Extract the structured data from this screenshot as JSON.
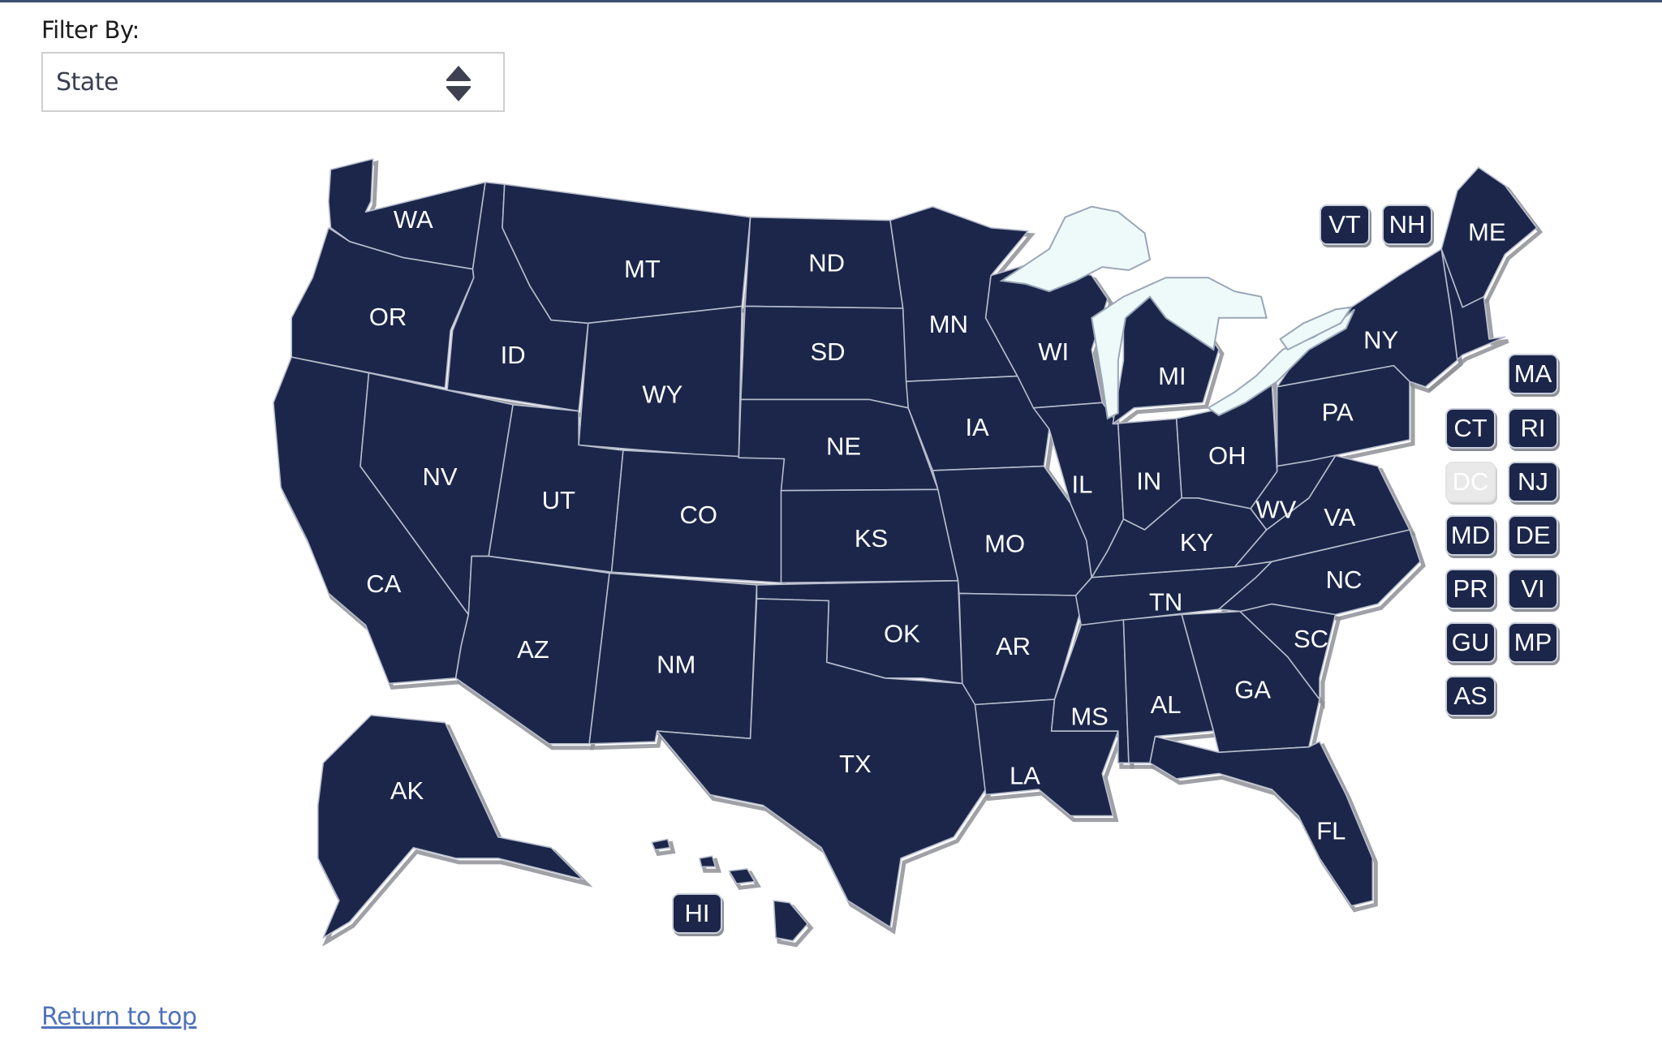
{
  "filter": {
    "label": "Filter By:",
    "selected": "State",
    "icon": "sort-updown-icon"
  },
  "colors": {
    "state_fill": "#1b264a",
    "state_border": "#b7bccb",
    "lake_fill": "#eefaf9",
    "disabled_chip": "#e9e9e9",
    "link": "#4f72b8"
  },
  "map": {
    "title": "United States map",
    "states": [
      {
        "abbr": "WA"
      },
      {
        "abbr": "OR"
      },
      {
        "abbr": "CA"
      },
      {
        "abbr": "ID"
      },
      {
        "abbr": "NV"
      },
      {
        "abbr": "MT"
      },
      {
        "abbr": "WY"
      },
      {
        "abbr": "UT"
      },
      {
        "abbr": "AZ"
      },
      {
        "abbr": "CO"
      },
      {
        "abbr": "NM"
      },
      {
        "abbr": "ND"
      },
      {
        "abbr": "SD"
      },
      {
        "abbr": "NE"
      },
      {
        "abbr": "KS"
      },
      {
        "abbr": "OK"
      },
      {
        "abbr": "TX"
      },
      {
        "abbr": "MN"
      },
      {
        "abbr": "IA"
      },
      {
        "abbr": "MO"
      },
      {
        "abbr": "AR"
      },
      {
        "abbr": "LA"
      },
      {
        "abbr": "WI"
      },
      {
        "abbr": "IL"
      },
      {
        "abbr": "MI"
      },
      {
        "abbr": "IN"
      },
      {
        "abbr": "OH"
      },
      {
        "abbr": "KY"
      },
      {
        "abbr": "TN"
      },
      {
        "abbr": "MS"
      },
      {
        "abbr": "AL"
      },
      {
        "abbr": "GA"
      },
      {
        "abbr": "FL"
      },
      {
        "abbr": "SC"
      },
      {
        "abbr": "NC"
      },
      {
        "abbr": "VA"
      },
      {
        "abbr": "WV"
      },
      {
        "abbr": "PA"
      },
      {
        "abbr": "NY"
      },
      {
        "abbr": "ME"
      },
      {
        "abbr": "AK"
      }
    ],
    "chips": [
      {
        "abbr": "VT",
        "disabled": false
      },
      {
        "abbr": "NH",
        "disabled": false
      },
      {
        "abbr": "MA",
        "disabled": false
      },
      {
        "abbr": "CT",
        "disabled": false
      },
      {
        "abbr": "RI",
        "disabled": false
      },
      {
        "abbr": "DC",
        "disabled": true
      },
      {
        "abbr": "NJ",
        "disabled": false
      },
      {
        "abbr": "MD",
        "disabled": false
      },
      {
        "abbr": "DE",
        "disabled": false
      },
      {
        "abbr": "PR",
        "disabled": false
      },
      {
        "abbr": "VI",
        "disabled": false
      },
      {
        "abbr": "GU",
        "disabled": false
      },
      {
        "abbr": "MP",
        "disabled": false
      },
      {
        "abbr": "AS",
        "disabled": false
      },
      {
        "abbr": "HI",
        "disabled": false
      }
    ]
  },
  "footer": {
    "return_link": "Return to top"
  }
}
